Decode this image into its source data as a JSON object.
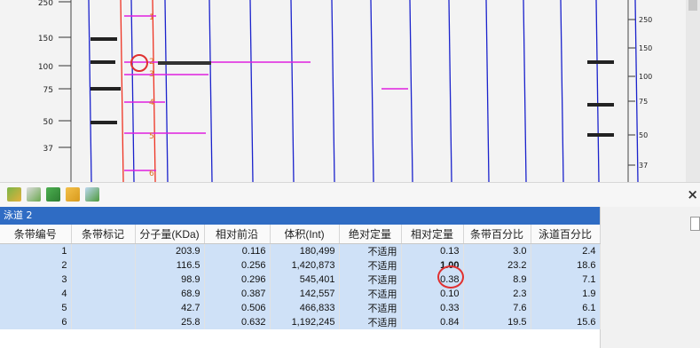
{
  "gel": {
    "left_ladder": [
      "250",
      "150",
      "100",
      "75",
      "50",
      "37"
    ],
    "right_ladder": [
      "250",
      "150",
      "100",
      "75",
      "50",
      "37"
    ],
    "band_numbers": [
      "1",
      "2",
      "3",
      "4",
      "5",
      "6"
    ],
    "colors": {
      "lane": "#1a22cc",
      "band_line": "#e020e0",
      "selected_lane": "#ee3322",
      "marker": "#e03030"
    }
  },
  "toolbar": {
    "icons": [
      "add-band-icon",
      "edit-band-icon",
      "delete-band-icon",
      "open-folder-icon",
      "export-icon"
    ],
    "close_glyph": "×"
  },
  "panel": {
    "lane_label": "泳道 2"
  },
  "table": {
    "headers": [
      "条带编号",
      "条带标记",
      "分子量(KDa)",
      "相对前沿",
      "体积(Int)",
      "绝对定量",
      "相对定量",
      "条带百分比",
      "泳道百分比"
    ],
    "rows": [
      {
        "no": "1",
        "label": "",
        "mw": "203.9",
        "rf": "0.116",
        "vol": "180,499",
        "abs": "不适用",
        "rel": "0.13",
        "band_pct": "3.0",
        "lane_pct": "2.4"
      },
      {
        "no": "2",
        "label": "",
        "mw": "116.5",
        "rf": "0.256",
        "vol": "1,420,873",
        "abs": "不适用",
        "rel": "1.00",
        "band_pct": "23.2",
        "lane_pct": "18.6"
      },
      {
        "no": "3",
        "label": "",
        "mw": "98.9",
        "rf": "0.296",
        "vol": "545,401",
        "abs": "不适用",
        "rel": "0.38",
        "band_pct": "8.9",
        "lane_pct": "7.1"
      },
      {
        "no": "4",
        "label": "",
        "mw": "68.9",
        "rf": "0.387",
        "vol": "142,557",
        "abs": "不适用",
        "rel": "0.10",
        "band_pct": "2.3",
        "lane_pct": "1.9"
      },
      {
        "no": "5",
        "label": "",
        "mw": "42.7",
        "rf": "0.506",
        "vol": "466,833",
        "abs": "不适用",
        "rel": "0.33",
        "band_pct": "7.6",
        "lane_pct": "6.1"
      },
      {
        "no": "6",
        "label": "",
        "mw": "25.8",
        "rf": "0.632",
        "vol": "1,192,245",
        "abs": "不适用",
        "rel": "0.84",
        "band_pct": "19.5",
        "lane_pct": "15.6"
      }
    ]
  }
}
